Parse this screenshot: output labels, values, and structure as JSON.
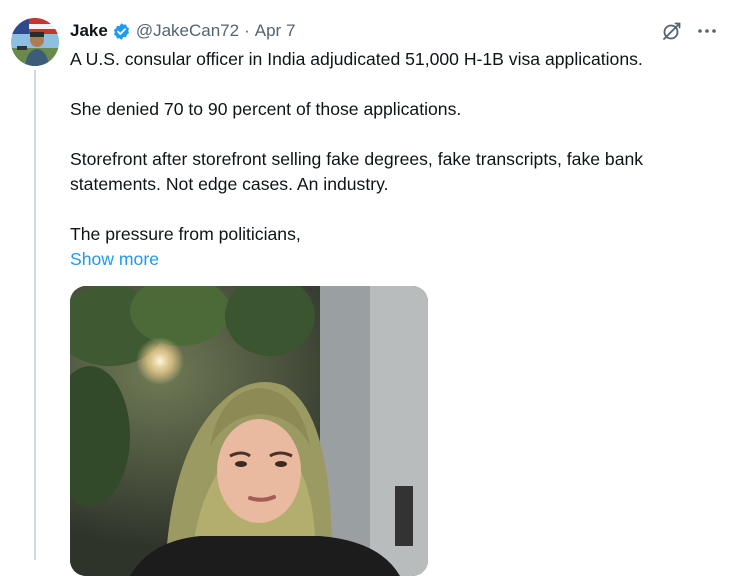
{
  "tweet": {
    "author_name": "Jake",
    "handle": "@JakeCan72",
    "separator": "·",
    "date": "Apr 7",
    "paragraphs": [
      "A U.S. consular officer in India adjudicated 51,000 H-1B visa applications.",
      "She denied 70 to 90 percent of those applications.",
      "Storefront after storefront selling fake degrees, fake transcripts, fake bank statements. Not edge cases. An industry.",
      "The pressure from politicians,"
    ],
    "show_more_label": "Show more"
  },
  "icons": {
    "verified": "verified-badge-icon",
    "grok": "grok-icon",
    "more": "more-horizontal-icon"
  },
  "colors": {
    "link": "#1d9bf0",
    "secondary_text": "#536471",
    "thread_line": "#cfd9de"
  }
}
